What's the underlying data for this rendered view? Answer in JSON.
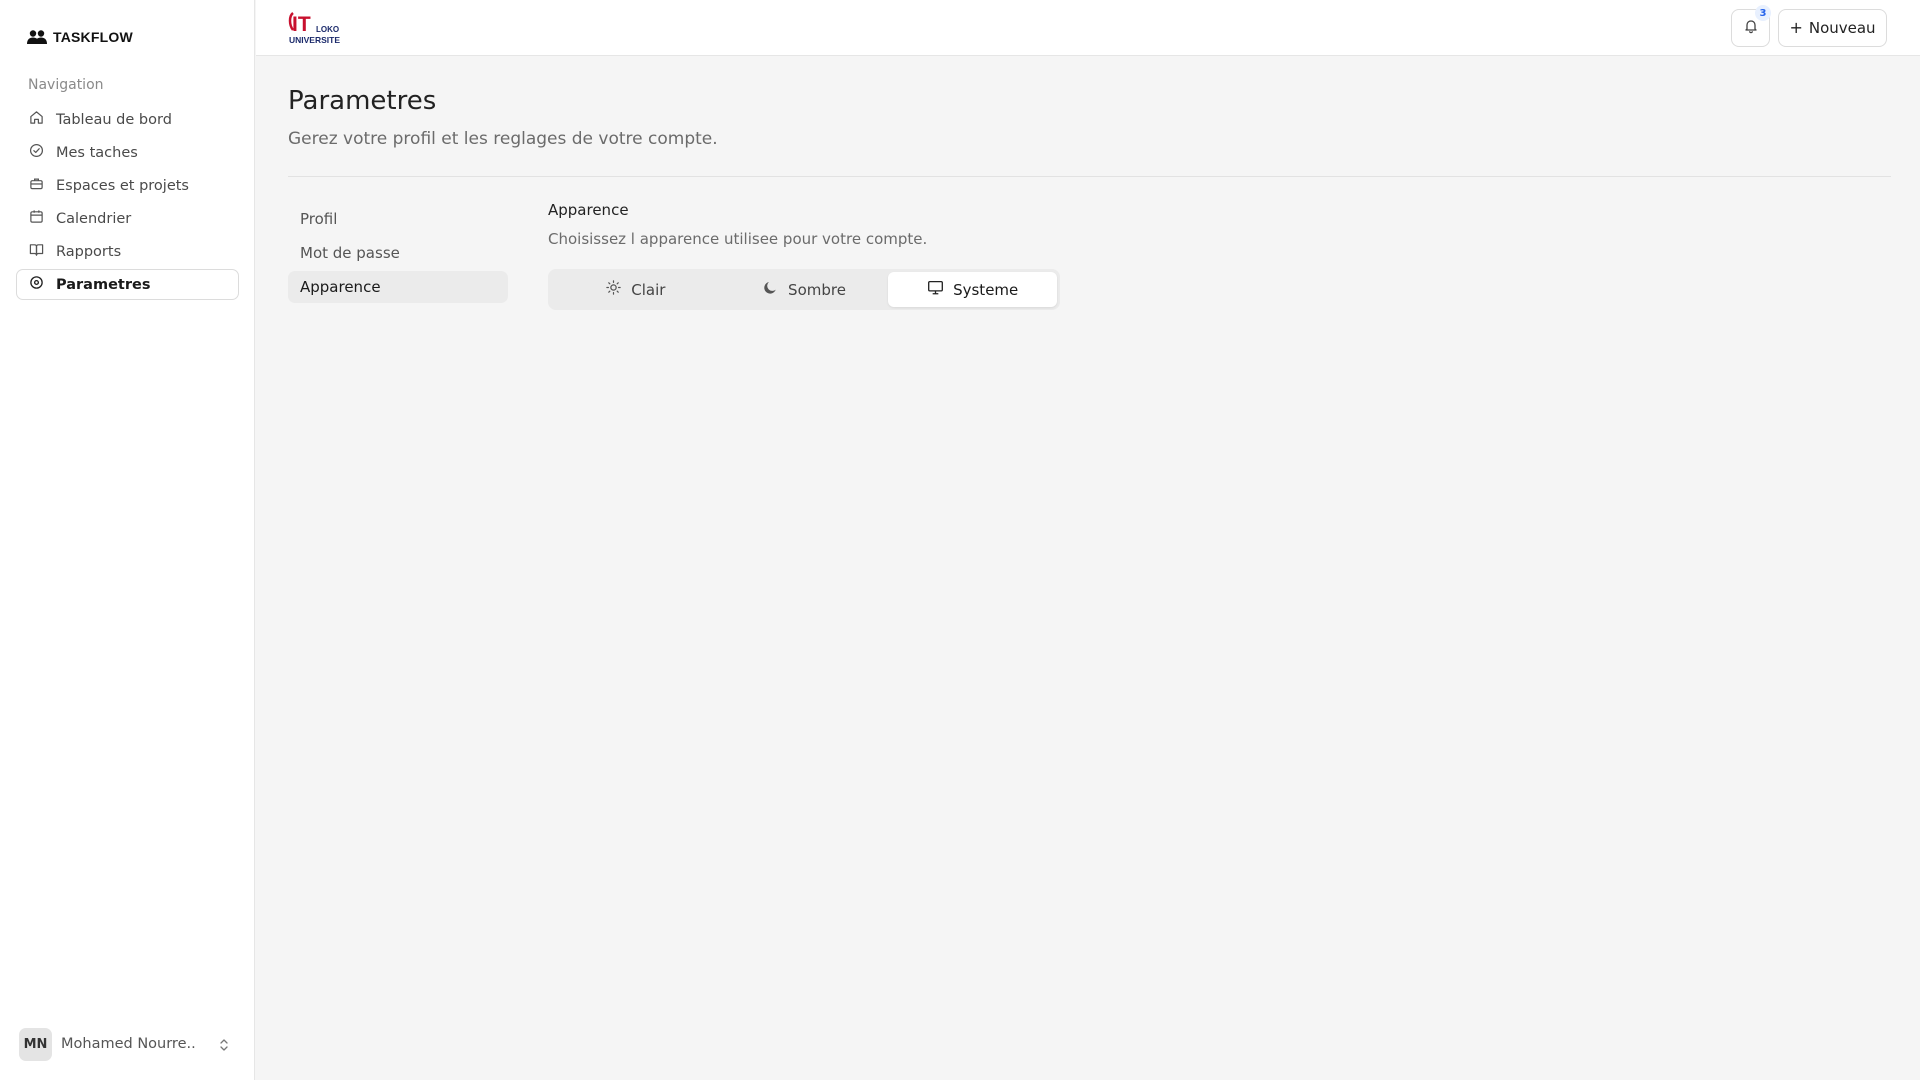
{
  "brand": {
    "name": "TASKFLOW",
    "icon": "users-icon"
  },
  "sidebar": {
    "heading": "Navigation",
    "items": [
      {
        "label": "Tableau de bord",
        "icon": "home-icon",
        "active": false
      },
      {
        "label": "Mes taches",
        "icon": "check-circle-icon",
        "active": false
      },
      {
        "label": "Espaces et projets",
        "icon": "briefcase-icon",
        "active": false
      },
      {
        "label": "Calendrier",
        "icon": "calendar-icon",
        "active": false
      },
      {
        "label": "Rapports",
        "icon": "book-open-icon",
        "active": false
      },
      {
        "label": "Parametres",
        "icon": "settings-icon",
        "active": true
      }
    ],
    "user": {
      "initials": "MN",
      "name": "Mohamed Nourre..."
    }
  },
  "header": {
    "logo": {
      "icon": "university-logo",
      "letters": "IT",
      "sub": "LOKO",
      "caption": "UNIVERSITE"
    },
    "notifications_count": "3",
    "new_button_label": "Nouveau"
  },
  "page": {
    "title": "Parametres",
    "subtitle": "Gerez votre profil et les reglages de votre compte.",
    "settings_nav": [
      {
        "label": "Profil",
        "active": false
      },
      {
        "label": "Mot de passe",
        "active": false
      },
      {
        "label": "Apparence",
        "active": true
      }
    ],
    "appearance": {
      "title": "Apparence",
      "description": "Choisissez l apparence utilisee pour votre compte.",
      "options": [
        {
          "label": "Clair",
          "icon": "sun-icon",
          "selected": false
        },
        {
          "label": "Sombre",
          "icon": "moon-icon",
          "selected": false
        },
        {
          "label": "Systeme",
          "icon": "monitor-icon",
          "selected": true
        }
      ]
    }
  },
  "colors": {
    "background": "#f5f5f5",
    "surface": "#ffffff",
    "border": "#e6e6e6",
    "logo_red": "#c8102e",
    "logo_navy": "#1b2a6b",
    "badge_blue": "#2563eb"
  }
}
